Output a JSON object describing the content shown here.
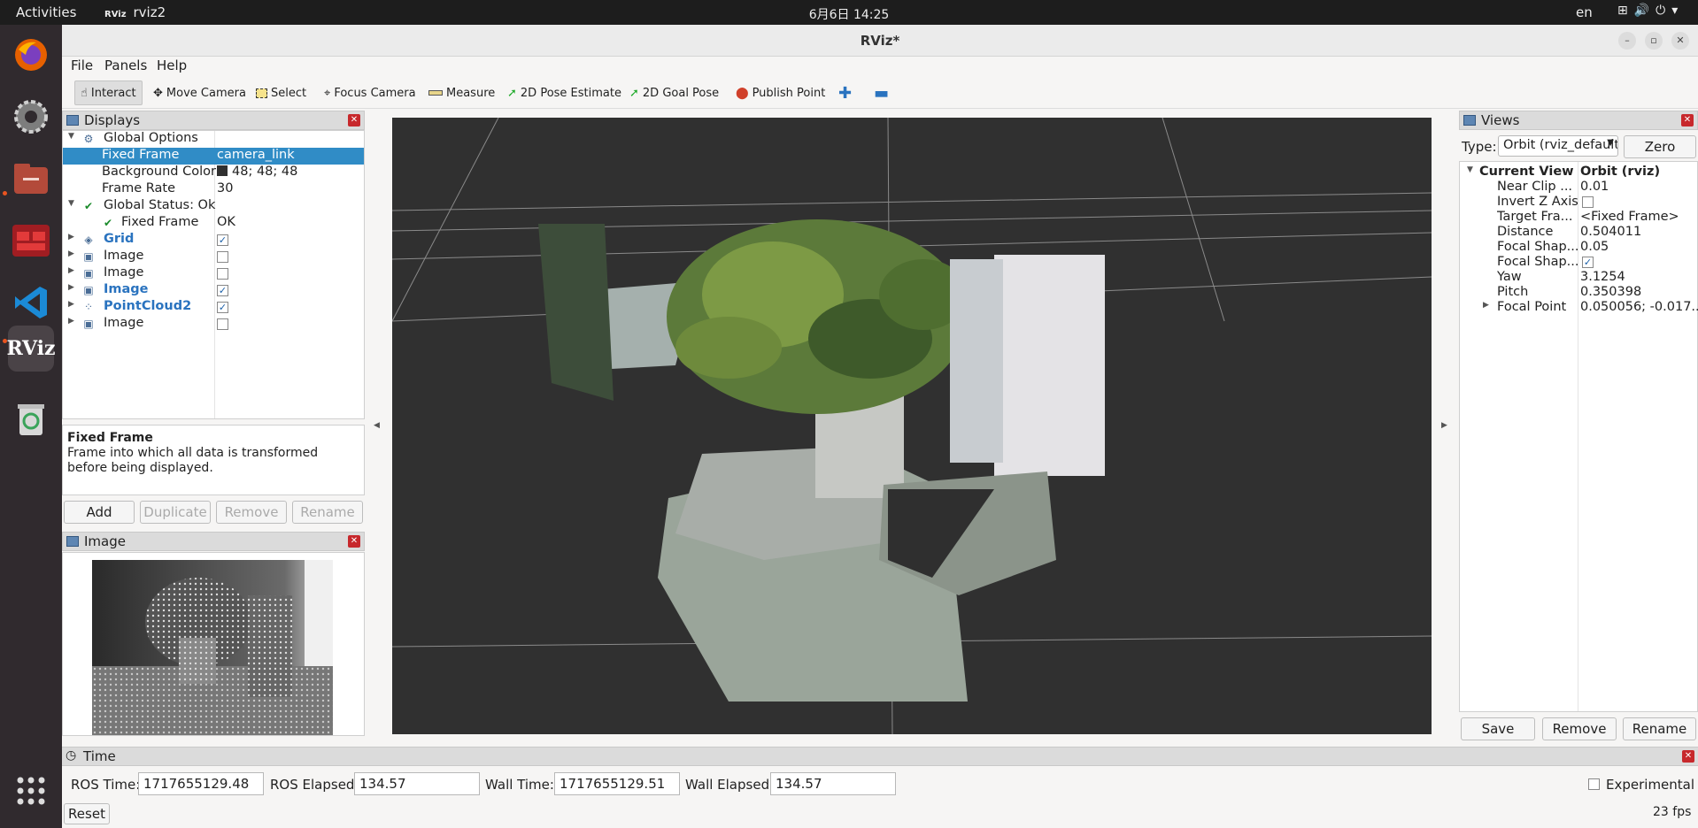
{
  "topbar": {
    "activities": "Activities",
    "app_name": "rviz2",
    "app_icon_text": "RViz",
    "clock": "6月6日  14:25",
    "lang": "en"
  },
  "window": {
    "title": "RViz*"
  },
  "menu": {
    "file": "File",
    "panels": "Panels",
    "help": "Help"
  },
  "toolbar": {
    "interact": "Interact",
    "move_camera": "Move Camera",
    "select": "Select",
    "focus_camera": "Focus Camera",
    "measure": "Measure",
    "pose_estimate": "2D Pose Estimate",
    "goal_pose": "2D Goal Pose",
    "publish_point": "Publish Point"
  },
  "displays": {
    "title": "Displays",
    "rows": [
      {
        "label": "Global Options"
      },
      {
        "label": "Fixed Frame",
        "value": "camera_link"
      },
      {
        "label": "Background Color",
        "value": "48; 48; 48"
      },
      {
        "label": "Frame Rate",
        "value": "30"
      },
      {
        "label": "Global Status: Ok"
      },
      {
        "label": "Fixed Frame",
        "value": "OK"
      },
      {
        "label": "Grid",
        "checked": true
      },
      {
        "label": "Image",
        "checked": false
      },
      {
        "label": "Image",
        "checked": false
      },
      {
        "label": "Image",
        "checked": true
      },
      {
        "label": "PointCloud2",
        "checked": true
      },
      {
        "label": "Image",
        "checked": false
      }
    ],
    "background_color": "#303030",
    "desc_title": "Fixed Frame",
    "desc_body": "Frame into which all data is transformed before being displayed.",
    "buttons": {
      "add": "Add",
      "duplicate": "Duplicate",
      "remove": "Remove",
      "rename": "Rename"
    }
  },
  "image_panel": {
    "title": "Image"
  },
  "views": {
    "title": "Views",
    "type_label": "Type:",
    "type_value": "Orbit (rviz_default",
    "zero": "Zero",
    "header_key": "Current View",
    "header_value": "Orbit (rviz)",
    "rows": [
      {
        "k": "Near Clip ...",
        "v": "0.01"
      },
      {
        "k": "Invert Z Axis",
        "v": ""
      },
      {
        "k": "Target Fra...",
        "v": "<Fixed Frame>"
      },
      {
        "k": "Distance",
        "v": "0.504011"
      },
      {
        "k": "Focal Shap...",
        "v": "0.05"
      },
      {
        "k": "Focal Shap...",
        "v": ""
      },
      {
        "k": "Yaw",
        "v": "3.1254"
      },
      {
        "k": "Pitch",
        "v": "0.350398"
      },
      {
        "k": "Focal Point",
        "v": "0.050056; -0.017..."
      }
    ],
    "buttons": {
      "save": "Save",
      "remove": "Remove",
      "rename": "Rename"
    }
  },
  "time": {
    "title": "Time",
    "ros_time_label": "ROS Time:",
    "ros_time": "1717655129.48",
    "ros_elapsed_label": "ROS Elapsed:",
    "ros_elapsed": "134.57",
    "wall_time_label": "Wall Time:",
    "wall_time": "1717655129.51",
    "wall_elapsed_label": "Wall Elapsed:",
    "wall_elapsed": "134.57",
    "experimental": "Experimental",
    "reset": "Reset",
    "fps": "23 fps"
  }
}
